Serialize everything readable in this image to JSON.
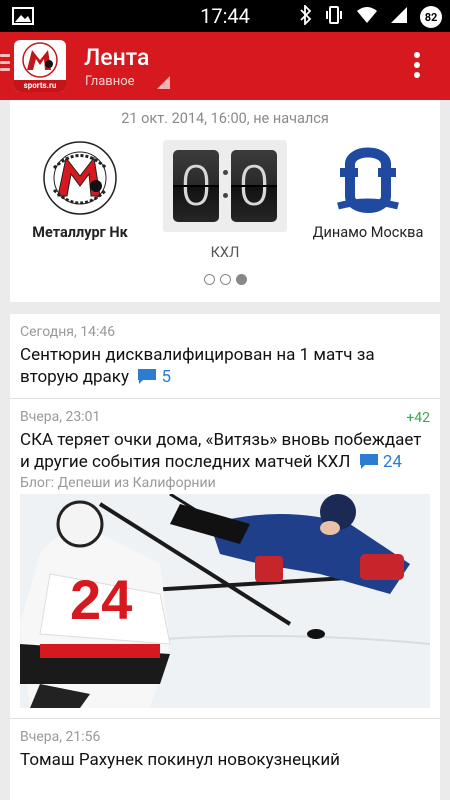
{
  "status_bar": {
    "time": "17:44",
    "battery": "82",
    "icons": [
      "image-icon",
      "bluetooth-icon",
      "vibrate-icon",
      "wifi-icon",
      "signal-icon",
      "battery-icon"
    ]
  },
  "app_bar": {
    "title": "Лента",
    "subtitle": "Главное",
    "logo_text": "sports.ru",
    "color": "#d6191f"
  },
  "match": {
    "datetime": "21 окт. 2014, 16:00, не начался",
    "home_team": "Металлург Нк",
    "away_team": "Динамо Москва",
    "home_score": "0",
    "away_score": "0",
    "league": "КХЛ",
    "pages": 3,
    "active_page": 3
  },
  "news": [
    {
      "time": "Сегодня, 14:46",
      "title": "Сентюрин дисквалифицирован на 1 матч за вторую драку",
      "comments": "5"
    },
    {
      "time": "Вчера, 23:01",
      "rating": "+42",
      "title": "СКА теряет очки дома, «Витязь» вновь побеждает и другие события последних матчей КХЛ",
      "comments": "24",
      "blog": "Блог: Депеши из Калифорнии"
    },
    {
      "time": "Вчера, 21:56",
      "title": "Томаш Рахунек покинул новокузнецкий"
    }
  ],
  "colors": {
    "accent": "#d6191f",
    "comment_link": "#2b7cd3",
    "rating_positive": "#3aa84a"
  }
}
